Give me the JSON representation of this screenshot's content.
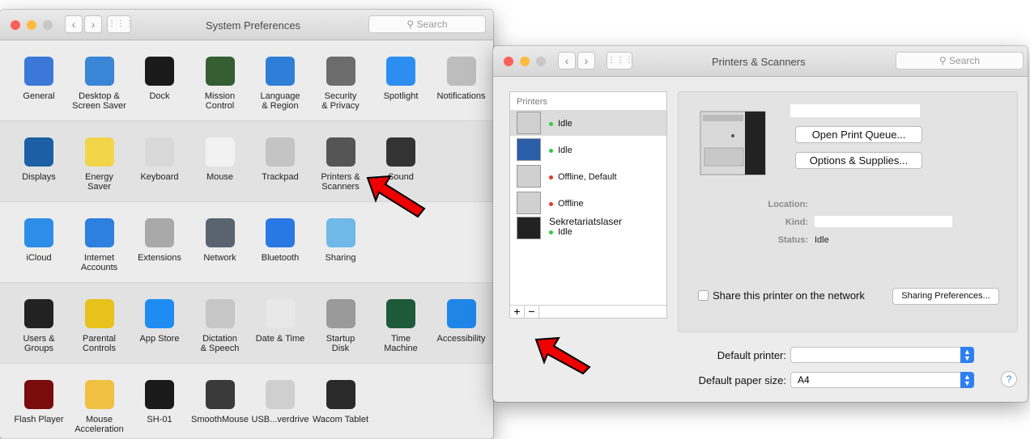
{
  "sysprefs": {
    "title": "System Preferences",
    "search_placeholder": "Search",
    "rows": [
      [
        {
          "name": "General",
          "icon": "general-icon",
          "bg": "#3c78d8"
        },
        {
          "name": "Desktop &\nScreen Saver",
          "icon": "desktop-icon",
          "bg": "#3a86d6"
        },
        {
          "name": "Dock",
          "icon": "dock-icon",
          "bg": "#1a1a1a"
        },
        {
          "name": "Mission\nControl",
          "icon": "mission-control-icon",
          "bg": "#355e32"
        },
        {
          "name": "Language\n& Region",
          "icon": "language-icon",
          "bg": "#2f7fd8"
        },
        {
          "name": "Security\n& Privacy",
          "icon": "security-icon",
          "bg": "#6c6c6c"
        },
        {
          "name": "Spotlight",
          "icon": "spotlight-icon",
          "bg": "#2b8ef0"
        },
        {
          "name": "Notifications",
          "icon": "notifications-icon",
          "bg": "#bdbdbd"
        }
      ],
      [
        {
          "name": "Displays",
          "icon": "displays-icon",
          "bg": "#1c5fa5"
        },
        {
          "name": "Energy\nSaver",
          "icon": "energy-saver-icon",
          "bg": "#f3d54a"
        },
        {
          "name": "Keyboard",
          "icon": "keyboard-icon",
          "bg": "#d8d8d8"
        },
        {
          "name": "Mouse",
          "icon": "mouse-icon",
          "bg": "#f2f2f2"
        },
        {
          "name": "Trackpad",
          "icon": "trackpad-icon",
          "bg": "#c4c4c4"
        },
        {
          "name": "Printers &\nScanners",
          "icon": "printers-icon",
          "bg": "#555555"
        },
        {
          "name": "Sound",
          "icon": "sound-icon",
          "bg": "#333333"
        }
      ],
      [
        {
          "name": "iCloud",
          "icon": "icloud-icon",
          "bg": "#2d8ee8"
        },
        {
          "name": "Internet\nAccounts",
          "icon": "internet-accounts-icon",
          "bg": "#2d7fe0"
        },
        {
          "name": "Extensions",
          "icon": "extensions-icon",
          "bg": "#a9a9a9"
        },
        {
          "name": "Network",
          "icon": "network-icon",
          "bg": "#5a6470"
        },
        {
          "name": "Bluetooth",
          "icon": "bluetooth-icon",
          "bg": "#2a78e4"
        },
        {
          "name": "Sharing",
          "icon": "sharing-icon",
          "bg": "#6fb8e8"
        }
      ],
      [
        {
          "name": "Users &\nGroups",
          "icon": "users-icon",
          "bg": "#222222"
        },
        {
          "name": "Parental\nControls",
          "icon": "parental-controls-icon",
          "bg": "#e8c21c"
        },
        {
          "name": "App Store",
          "icon": "app-store-icon",
          "bg": "#1e8cf0"
        },
        {
          "name": "Dictation\n& Speech",
          "icon": "dictation-icon",
          "bg": "#c6c6c6"
        },
        {
          "name": "Date & Time",
          "icon": "date-time-icon",
          "bg": "#e8e8e8"
        },
        {
          "name": "Startup\nDisk",
          "icon": "startup-disk-icon",
          "bg": "#9a9a9a"
        },
        {
          "name": "Time\nMachine",
          "icon": "time-machine-icon",
          "bg": "#1d5a3a"
        },
        {
          "name": "Accessibility",
          "icon": "accessibility-icon",
          "bg": "#1f86e8"
        }
      ],
      [
        {
          "name": "Flash Player",
          "icon": "flash-player-icon",
          "bg": "#7a0c0c"
        },
        {
          "name": "Mouse\nAcceleration",
          "icon": "mouse-acceleration-icon",
          "bg": "#f0c040"
        },
        {
          "name": "SH-01",
          "icon": "sh01-icon",
          "bg": "#1a1a1a"
        },
        {
          "name": "SmoothMouse",
          "icon": "smoothmouse-icon",
          "bg": "#3a3a3a"
        },
        {
          "name": "USB...verdrive",
          "icon": "usb-overdrive-icon",
          "bg": "#cfcfcf"
        },
        {
          "name": "Wacom Tablet",
          "icon": "wacom-icon",
          "bg": "#2a2a2a"
        }
      ]
    ]
  },
  "printers": {
    "title": "Printers & Scanners",
    "search_placeholder": "Search",
    "list_header": "Printers",
    "items": [
      {
        "name": "",
        "status": "Idle",
        "status_color": "#2ecc40"
      },
      {
        "name": "",
        "status": "Idle",
        "status_color": "#2ecc40"
      },
      {
        "name": "",
        "status": "Offline, Default",
        "status_color": "#e8392a"
      },
      {
        "name": "",
        "status": "Offline",
        "status_color": "#e8392a"
      },
      {
        "name": "Sekretariatslaser",
        "status": "Idle",
        "status_color": "#2ecc40"
      }
    ],
    "add_label": "+",
    "remove_label": "−",
    "open_queue": "Open Print Queue...",
    "options_supplies": "Options & Supplies...",
    "location_label": "Location:",
    "kind_label": "Kind:",
    "status_label": "Status:",
    "status_value": "Idle",
    "share_label": "Share this printer on the network",
    "sharing_prefs": "Sharing Preferences...",
    "default_printer_label": "Default printer:",
    "default_printer_value": "",
    "default_paper_label": "Default paper size:",
    "default_paper_value": "A4",
    "help": "?"
  }
}
